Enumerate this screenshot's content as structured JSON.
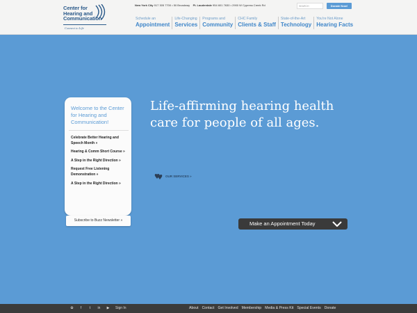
{
  "colors": {
    "background": "#5b9bd5",
    "header": "#f4f4f3",
    "nav_accent": "#3f86c9",
    "footer": "#3b3b3b",
    "appointment_bar": "#3a3a3a"
  },
  "logo": {
    "line1": "Center for",
    "line2": "Hearing and",
    "line3": "Communication",
    "tagline": "Connect to Life"
  },
  "header": {
    "ny_city": "New York City",
    "ny_details": "917 305 7700 • 50 Broadway",
    "fl_city": "Ft. Lauderdale",
    "fl_details": "954 601 7630 • 2900 W Cypress Creek Rd",
    "search_placeholder": "SEARCH",
    "donate_label": "Donate Now!"
  },
  "nav": [
    {
      "top": "Schedule an",
      "bottom": "Appointment"
    },
    {
      "top": "Life-Changing",
      "bottom": "Services"
    },
    {
      "top": "Programs and",
      "bottom": "Community"
    },
    {
      "top": "CHC Family",
      "bottom": "Clients & Staff"
    },
    {
      "top": "State-of-the-Art",
      "bottom": "Technology"
    },
    {
      "top": "You're Not Alone",
      "bottom": "Hearing Facts"
    }
  ],
  "sidebar": {
    "title": "Welcome to the Center for Hearing and Communication!",
    "links": [
      "Celebrate Better Hearing and Speech Month »",
      "Hearing & Comm Short Course  »",
      "A Step in the Right Direction  »",
      "Request Free Listening Demonstration »",
      "A Step in the Right Direction »"
    ]
  },
  "newsletter_label": "Subscribe to Buzz Newsletter »",
  "hero": {
    "headline": "Life-affirming hearing health care for people of all ages."
  },
  "services_label": "OUR SERVICES »",
  "appointment_label": "Make an Appointment Today",
  "footer": {
    "social_icons": [
      "share-icon",
      "facebook-icon",
      "twitter-icon",
      "linkedin-icon",
      "youtube-icon"
    ],
    "signin_label": "Sign In",
    "links": [
      "About",
      "Contact",
      "Get Involved",
      "Membership",
      "Media & Press Kit",
      "Special Events",
      "Donate"
    ]
  }
}
